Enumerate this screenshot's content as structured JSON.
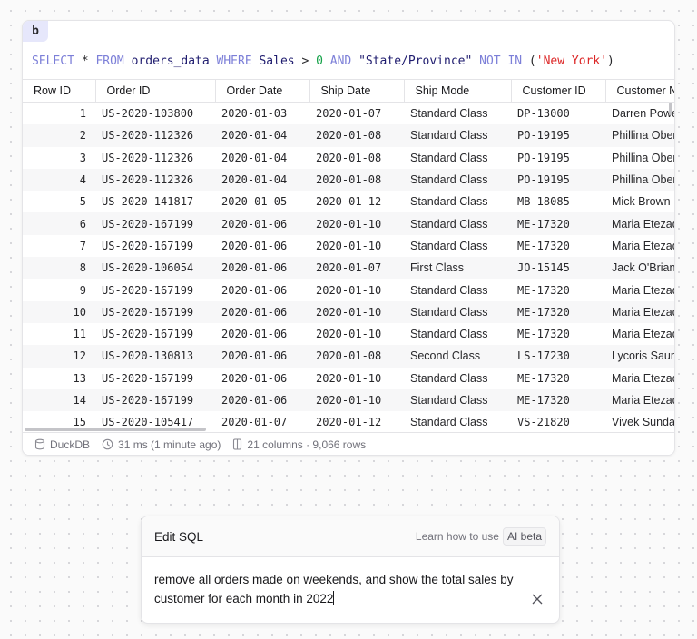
{
  "cell": {
    "tag": "b",
    "sql": [
      {
        "t": "SELECT",
        "c": "kw"
      },
      {
        "t": " * ",
        "c": "op"
      },
      {
        "t": "FROM",
        "c": "kw"
      },
      {
        "t": " ",
        "c": "op"
      },
      {
        "t": "orders_data",
        "c": "id"
      },
      {
        "t": " ",
        "c": "op"
      },
      {
        "t": "WHERE",
        "c": "kw"
      },
      {
        "t": " ",
        "c": "op"
      },
      {
        "t": "Sales",
        "c": "id"
      },
      {
        "t": " > ",
        "c": "op"
      },
      {
        "t": "0",
        "c": "num"
      },
      {
        "t": " ",
        "c": "op"
      },
      {
        "t": "AND",
        "c": "kw"
      },
      {
        "t": " ",
        "c": "op"
      },
      {
        "t": "\"State/Province\"",
        "c": "qid"
      },
      {
        "t": " ",
        "c": "op"
      },
      {
        "t": "NOT",
        "c": "kw"
      },
      {
        "t": " ",
        "c": "op"
      },
      {
        "t": "IN",
        "c": "kw"
      },
      {
        "t": " (",
        "c": "op"
      },
      {
        "t": "'New York'",
        "c": "str"
      },
      {
        "t": ")",
        "c": "op"
      }
    ],
    "columns": [
      "Row ID",
      "Order ID",
      "Order Date",
      "Ship Date",
      "Ship Mode",
      "Customer ID",
      "Customer Na"
    ],
    "rows": [
      [
        "1",
        "US-2020-103800",
        "2020-01-03",
        "2020-01-07",
        "Standard Class",
        "DP-13000",
        "Darren Powers"
      ],
      [
        "2",
        "US-2020-112326",
        "2020-01-04",
        "2020-01-08",
        "Standard Class",
        "PO-19195",
        "Phillina Ober"
      ],
      [
        "3",
        "US-2020-112326",
        "2020-01-04",
        "2020-01-08",
        "Standard Class",
        "PO-19195",
        "Phillina Ober"
      ],
      [
        "4",
        "US-2020-112326",
        "2020-01-04",
        "2020-01-08",
        "Standard Class",
        "PO-19195",
        "Phillina Ober"
      ],
      [
        "5",
        "US-2020-141817",
        "2020-01-05",
        "2020-01-12",
        "Standard Class",
        "MB-18085",
        "Mick Brown"
      ],
      [
        "6",
        "US-2020-167199",
        "2020-01-06",
        "2020-01-10",
        "Standard Class",
        "ME-17320",
        "Maria Etezadi"
      ],
      [
        "7",
        "US-2020-167199",
        "2020-01-06",
        "2020-01-10",
        "Standard Class",
        "ME-17320",
        "Maria Etezadi"
      ],
      [
        "8",
        "US-2020-106054",
        "2020-01-06",
        "2020-01-07",
        "First Class",
        "JO-15145",
        "Jack O'Briant"
      ],
      [
        "9",
        "US-2020-167199",
        "2020-01-06",
        "2020-01-10",
        "Standard Class",
        "ME-17320",
        "Maria Etezadi"
      ],
      [
        "10",
        "US-2020-167199",
        "2020-01-06",
        "2020-01-10",
        "Standard Class",
        "ME-17320",
        "Maria Etezadi"
      ],
      [
        "11",
        "US-2020-167199",
        "2020-01-06",
        "2020-01-10",
        "Standard Class",
        "ME-17320",
        "Maria Etezadi"
      ],
      [
        "12",
        "US-2020-130813",
        "2020-01-06",
        "2020-01-08",
        "Second Class",
        "LS-17230",
        "Lycoris Saunders"
      ],
      [
        "13",
        "US-2020-167199",
        "2020-01-06",
        "2020-01-10",
        "Standard Class",
        "ME-17320",
        "Maria Etezadi"
      ],
      [
        "14",
        "US-2020-167199",
        "2020-01-06",
        "2020-01-10",
        "Standard Class",
        "ME-17320",
        "Maria Etezadi"
      ],
      [
        "15",
        "US-2020-105417",
        "2020-01-07",
        "2020-01-12",
        "Standard Class",
        "VS-21820",
        "Vivek Sundaresam"
      ]
    ],
    "footer": {
      "engine": "DuckDB",
      "timing": "31 ms (1 minute ago)",
      "shape": "21 columns · 9,066 rows"
    }
  },
  "edit": {
    "title": "Edit SQL",
    "learn": "Learn how to use",
    "badge": "AI beta",
    "prompt": "remove all orders made on weekends, and show the total sales by customer for each month in 2022"
  }
}
